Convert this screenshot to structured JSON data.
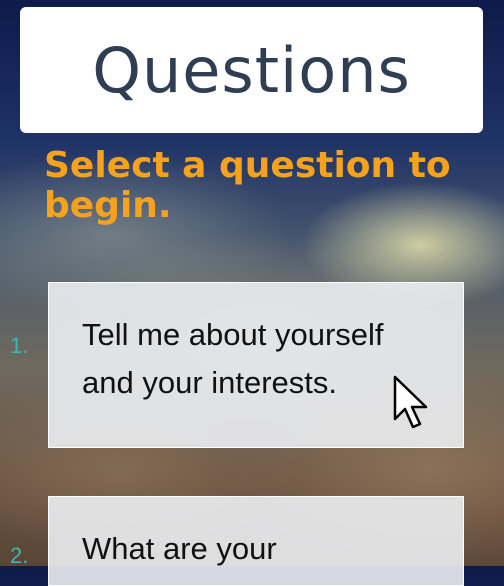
{
  "header": {
    "title": "Questions"
  },
  "prompt": "Select a question to begin.",
  "questions": [
    {
      "number": "1.",
      "text": "Tell me about yourself and your interests."
    },
    {
      "number": "2.",
      "text": "What are your"
    }
  ],
  "colors": {
    "accent": "#f7a21c",
    "number": "#39b9b0",
    "title": "#2f3e52"
  },
  "icons": {
    "pointer": "mouse-pointer-icon"
  }
}
